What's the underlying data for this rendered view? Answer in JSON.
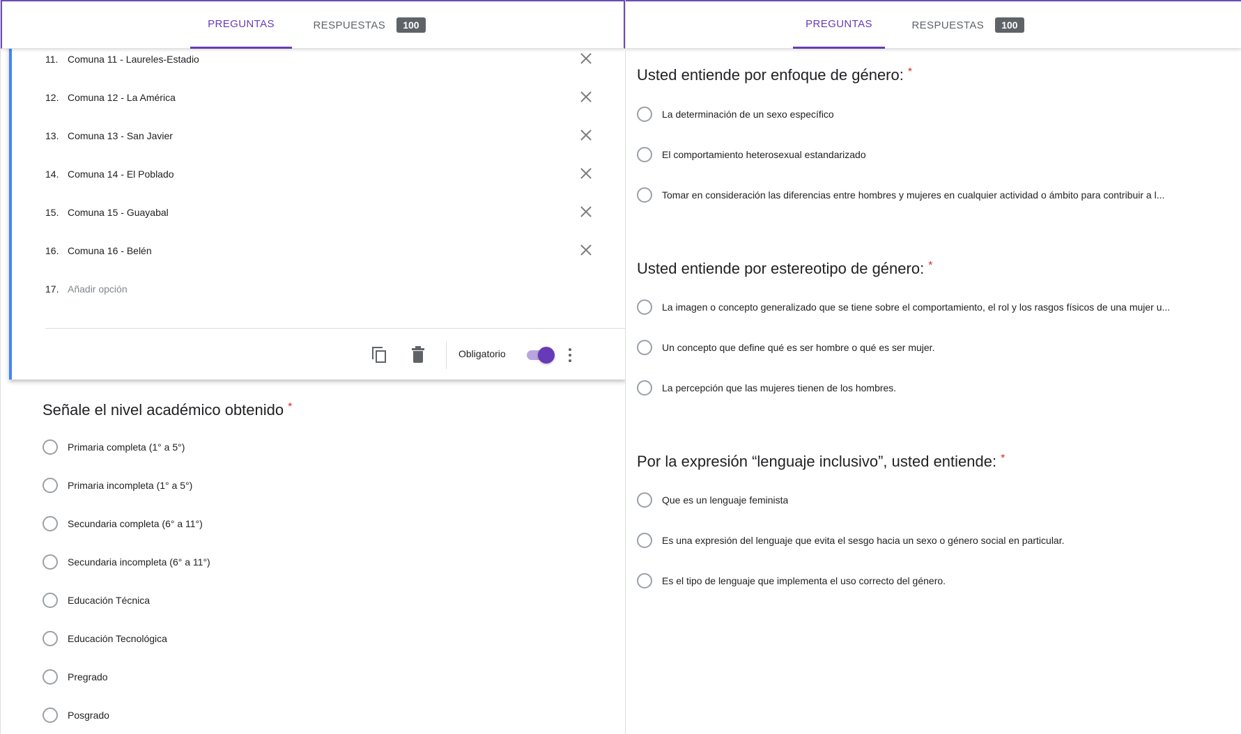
{
  "left": {
    "tabs": {
      "questions": "PREGUNTAS",
      "responses": "RESPUESTAS",
      "responses_count": "100"
    },
    "options": [
      {
        "num": "11.",
        "label": "Comuna 11 - Laureles-Estadio"
      },
      {
        "num": "12.",
        "label": "Comuna 12 - La América"
      },
      {
        "num": "13.",
        "label": "Comuna 13 - San Javier"
      },
      {
        "num": "14.",
        "label": "Comuna 14 - El Poblado"
      },
      {
        "num": "15.",
        "label": "Comuna 15 - Guayabal"
      },
      {
        "num": "16.",
        "label": "Comuna 16 - Belén"
      }
    ],
    "add_option": {
      "num": "17.",
      "label": "Añadir opción"
    },
    "required_label": "Obligatorio",
    "required_on": true,
    "question2": {
      "title": "Señale el nivel académico obtenido",
      "star": "*",
      "options": [
        "Primaria completa (1° a 5°)",
        "Primaria incompleta (1° a 5°)",
        "Secundaria completa (6° a 11°)",
        "Secundaria incompleta (6° a 11°)",
        "Educación Técnica",
        "Educación Tecnológica",
        "Pregrado",
        "Posgrado"
      ]
    }
  },
  "right": {
    "tabs": {
      "questions": "PREGUNTAS",
      "responses": "RESPUESTAS",
      "responses_count": "100"
    },
    "questions": [
      {
        "title": "Usted entiende por enfoque de género:",
        "star": "*",
        "options": [
          "La determinación de un sexo específico",
          "El comportamiento heterosexual estandarizado",
          "Tomar en consideración las diferencias entre hombres y mujeres en cualquier actividad o ámbito para contribuir a l..."
        ]
      },
      {
        "title": "Usted entiende por estereotipo de género:",
        "star": "*",
        "options": [
          "La imagen o concepto generalizado que se tiene sobre el comportamiento, el rol y los rasgos físicos de una mujer u...",
          "Un concepto que define qué es ser hombre o qué es ser mujer.",
          "La percepción que las mujeres tienen de los hombres."
        ]
      },
      {
        "title": "Por la expresión “lenguaje inclusivo”, usted entiende:",
        "star": "*",
        "options": [
          "Que es un lenguaje feminista",
          "Es una expresión del lenguaje que evita el sesgo hacia un sexo o género social en particular.",
          "Es el tipo de lenguaje que implementa el uso correcto del género."
        ]
      }
    ]
  },
  "colors": {
    "accent": "#673ab7",
    "card_border": "#4285f4",
    "required": "#d93025"
  }
}
